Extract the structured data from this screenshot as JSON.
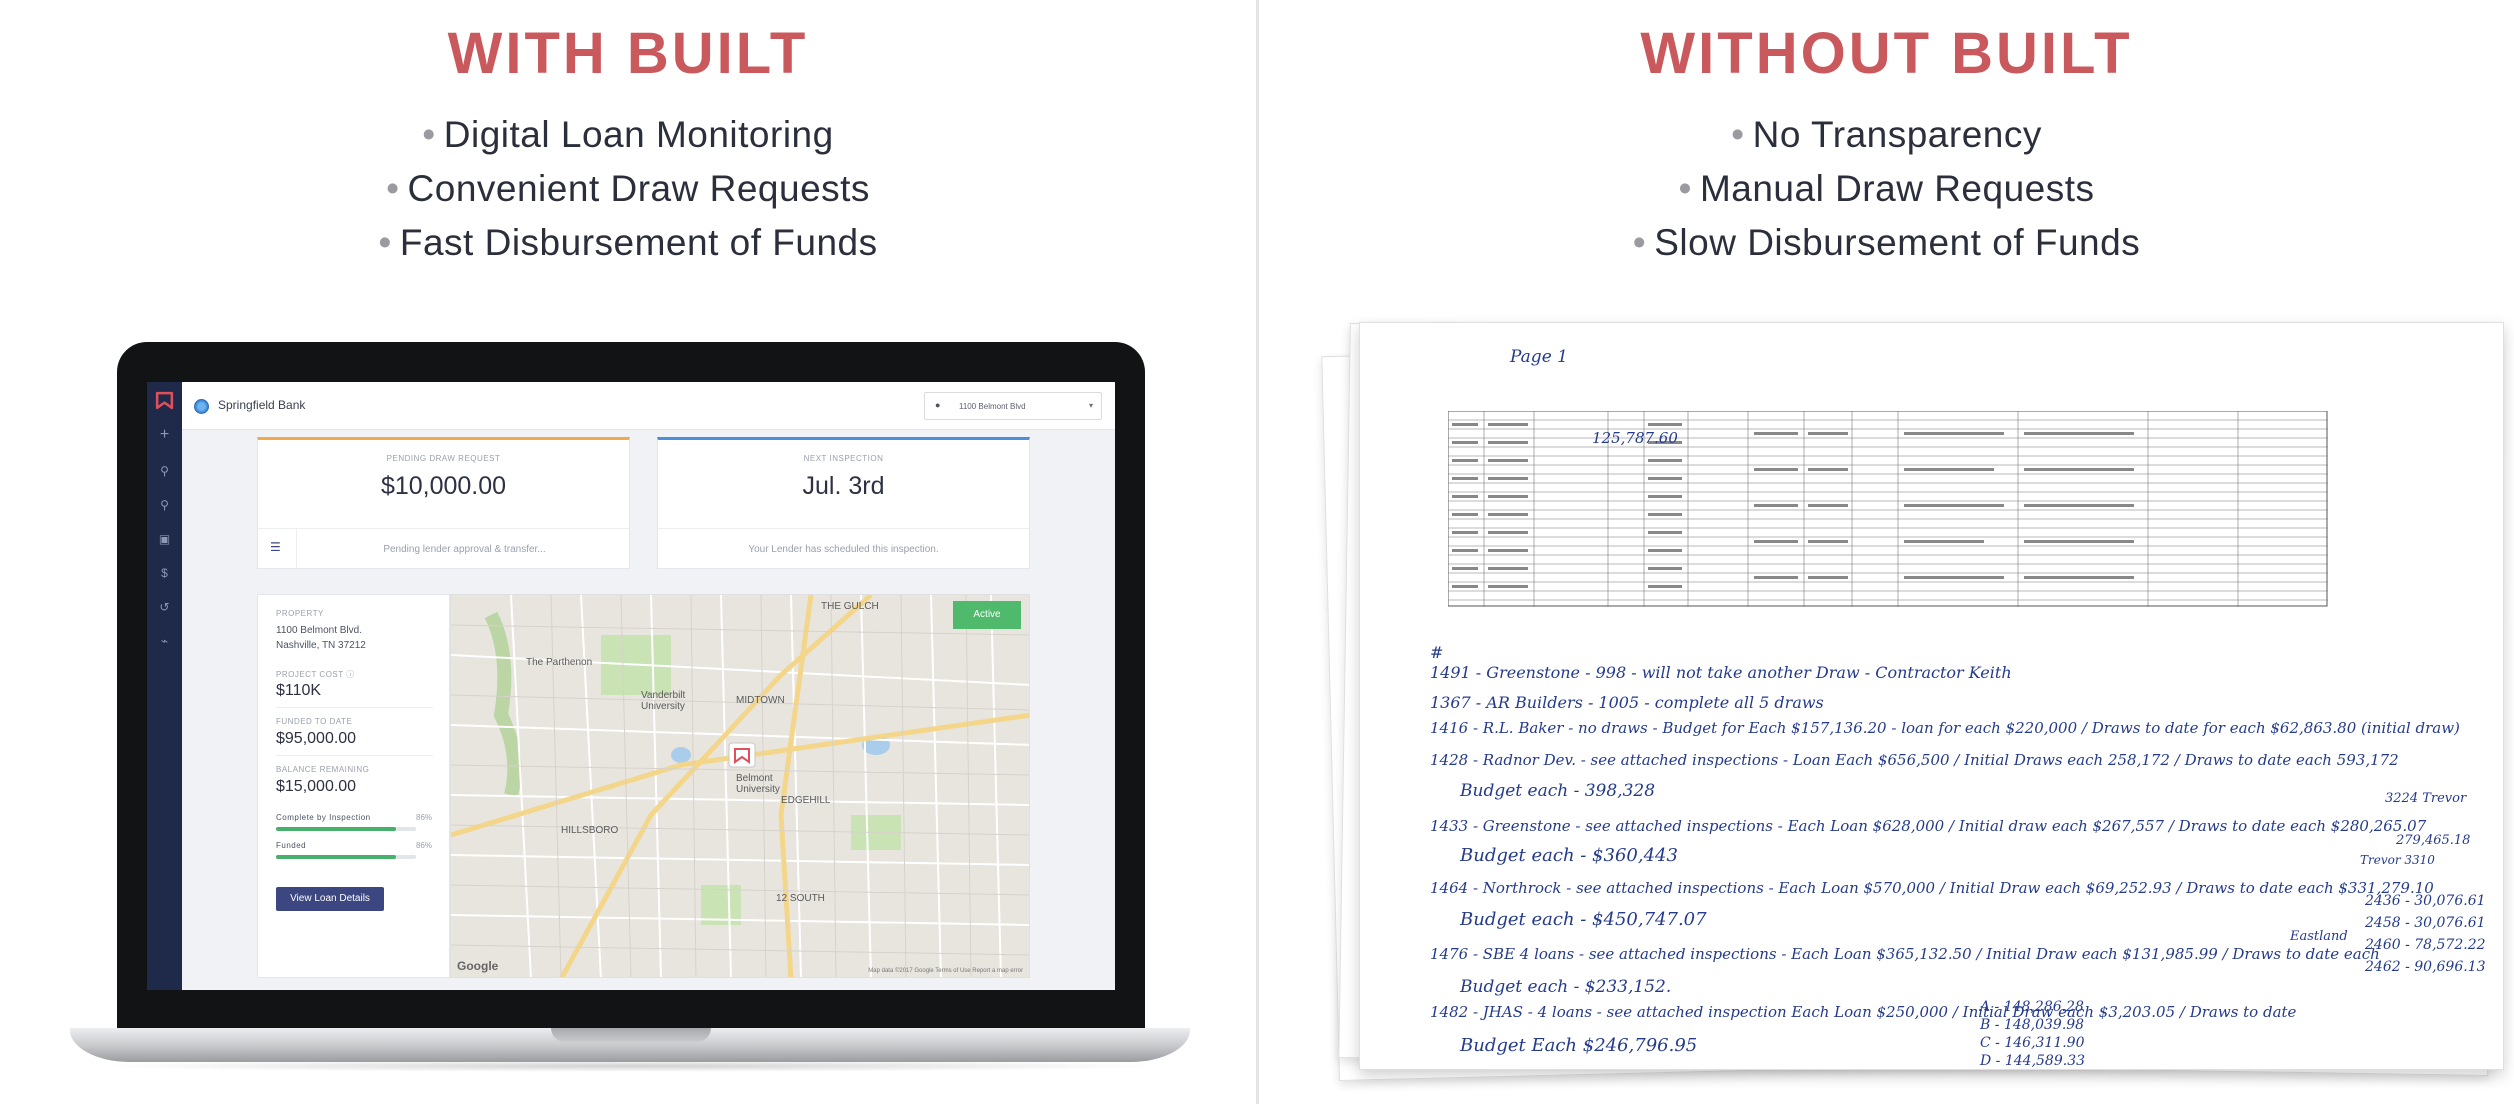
{
  "left": {
    "heading": "WITH BUILT",
    "bullets": [
      "Digital Loan Monitoring",
      "Convenient Draw Requests",
      "Fast Disbursement of Funds"
    ]
  },
  "right": {
    "heading": "WITHOUT BUILT",
    "bullets": [
      "No Transparency",
      "Manual Draw Requests",
      "Slow Disbursement of Funds"
    ]
  },
  "app": {
    "bank_name": "Springfield Bank",
    "address_select": "1100 Belmont Blvd",
    "pending_card": {
      "label": "PENDING DRAW REQUEST",
      "value": "$10,000.00",
      "note": "Pending lender approval & transfer..."
    },
    "inspection_card": {
      "label": "NEXT INSPECTION",
      "value": "Jul. 3rd",
      "note": "Your Lender has scheduled this inspection."
    },
    "property": {
      "label": "PROPERTY",
      "address_line1": "1100 Belmont Blvd.",
      "address_line2": "Nashville, TN 37212",
      "cost_label": "PROJECT COST",
      "cost": "$110K",
      "funded_label": "FUNDED TO DATE",
      "funded": "$95,000.00",
      "balance_label": "BALANCE REMAINING",
      "balance": "$15,000.00",
      "complete_label": "Complete by Inspection",
      "complete_pct": "86%",
      "complete_fraction": 0.86,
      "funded_bar_label": "Funded",
      "funded_pct": "86%",
      "funded_fraction": 0.86,
      "button": "View Loan Details"
    },
    "map": {
      "status": "Active",
      "labels": [
        "THE GULCH",
        "EDGEHILL",
        "MIDTOWN",
        "Vanderbilt University",
        "Belmont University",
        "12 SOUTH",
        "The Parthenon",
        "HILLSBORO"
      ],
      "attribution": "Map data ©2017 Google   Terms of Use   Report a map error",
      "brand": "Google"
    }
  },
  "paper": {
    "page_label": "Page 1",
    "margin_number": "125,787.60",
    "hash_mark": "#",
    "lines": [
      "1491 - Greenstone - 998 - will not take another Draw - Contractor Keith",
      "1367 - AR Builders - 1005 - complete all 5 draws",
      "1416 - R.L. Baker - no draws - Budget for Each $157,136.20 - loan for each $220,000 / Draws to date for each $62,863.80 (initial draw)",
      "1428 - Radnor Dev. - see attached inspections - Loan Each $656,500 / Initial Draws each 258,172 / Draws to date each 593,172",
      "Budget each - 398,328",
      "1433 - Greenstone - see attached inspections - Each Loan $628,000 / Initial draw each $267,557 / Draws to date each $280,265.07",
      "Budget each - $360,443",
      "1464 - Northrock - see attached inspections - Each Loan $570,000 / Initial Draw each $69,252.93 / Draws to date each $331,279.10",
      "Budget each - $450,747.07",
      "1476 - SBE 4 loans - see attached inspections - Each Loan $365,132.50 / Initial Draw each $131,985.99 / Draws to date each",
      "Budget each - $233,152.",
      "1482 - JHAS - 4 loans - see attached inspection Each Loan $250,000 / Initial Draw each $3,203.05 / Draws to date",
      "Budget Each $246,796.95"
    ],
    "side_notes": [
      "3224 Trevor",
      "279,465.18",
      "Trevor 3310",
      "2436 - 30,076.61",
      "2458 - 30,076.61",
      "2460 - 78,572.22",
      "2462 - 90,696.13",
      "Eastland"
    ],
    "sub_notes": [
      "A - 148,286.28",
      "B - 148,039.98",
      "C - 146,311.90",
      "D - 144,589.33",
      "144,589.33"
    ]
  }
}
